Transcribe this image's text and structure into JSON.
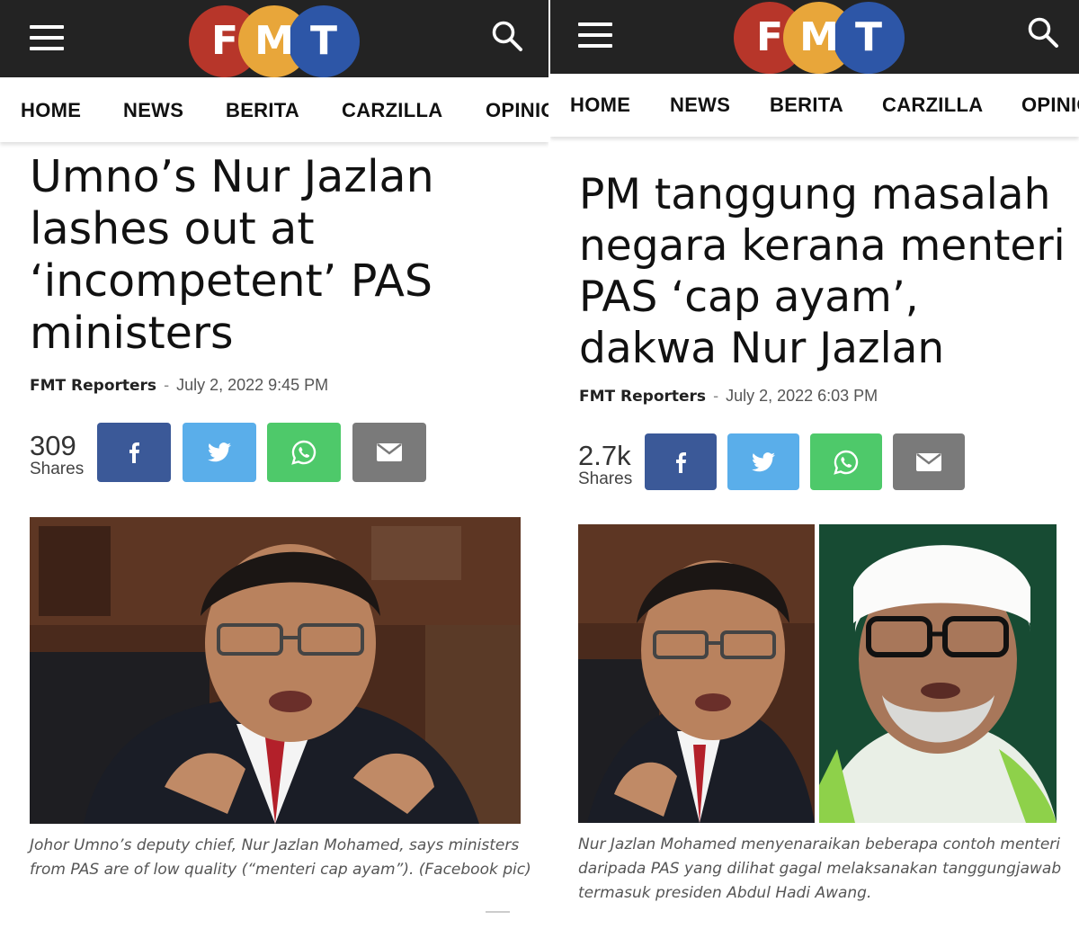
{
  "left": {
    "nav": [
      "HOME",
      "NEWS",
      "BERITA",
      "CARZILLA",
      "OPINION"
    ],
    "logo": [
      "F",
      "M",
      "T"
    ],
    "headline": "Umno’s Nur Jazlan lashes out at ‘incompetent’ PAS ministers",
    "author": "FMT Reporters",
    "separator": "-",
    "date": "July 2, 2022 9:45 PM",
    "shares_count": "309",
    "shares_label": "Shares",
    "caption": "Johor Umno’s deputy chief, Nur Jazlan Mohamed, says ministers from PAS are of low quality (“menteri cap ayam”). (Facebook pic)"
  },
  "right": {
    "nav": [
      "HOME",
      "NEWS",
      "BERITA",
      "CARZILLA",
      "OPINION"
    ],
    "logo": [
      "F",
      "M",
      "T"
    ],
    "headline": "PM tanggung masalah negara kerana menteri PAS ‘cap ayam’, dakwa Nur Jazlan",
    "author": "FMT Reporters",
    "separator": "-",
    "date": "July 2, 2022 6:03 PM",
    "shares_count": "2.7k",
    "shares_label": "Shares",
    "caption": "Nur Jazlan Mohamed menyenaraikan beberapa contoh menteri daripada PAS yang dilihat gagal melaksanakan tanggungjawab termasuk presiden Abdul Hadi Awang."
  },
  "icons": {
    "menu": "hamburger-menu-icon",
    "search": "search-icon",
    "share": [
      "facebook-icon",
      "twitter-icon",
      "whatsapp-icon",
      "email-icon"
    ]
  },
  "colors": {
    "topbar": "#232323",
    "logo_red": "#b7362a",
    "logo_yellow": "#e8a63a",
    "logo_blue": "#2d56a7",
    "facebook": "#3b5998",
    "twitter": "#5aaeea",
    "whatsapp": "#4ec96a",
    "email": "#7a7a7a"
  }
}
